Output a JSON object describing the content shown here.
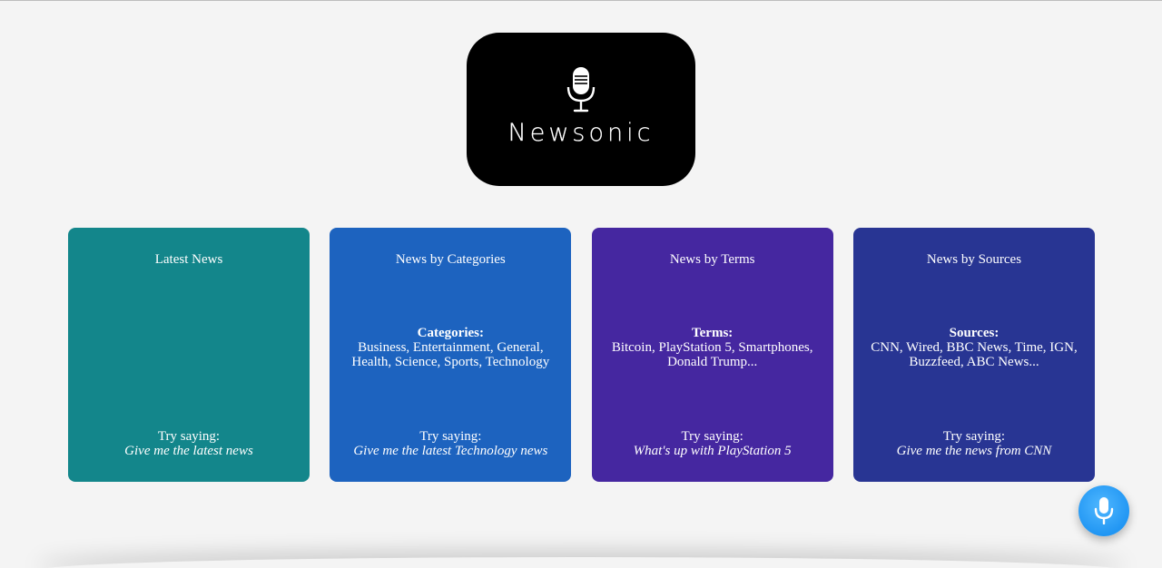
{
  "logo": {
    "wordmark": "Newsonic",
    "icon": "microphone-icon"
  },
  "cards": [
    {
      "title": "Latest News",
      "info_head": "",
      "info_body": "",
      "try_label": "Try saying:",
      "example": "Give me the latest news",
      "color": "#13868b"
    },
    {
      "title": "News by Categories",
      "info_head": "Categories:",
      "info_body": "Business, Entertainment, General, Health, Science, Sports, Technology",
      "try_label": "Try saying:",
      "example": "Give me the latest Technology news",
      "color": "#1d63bf"
    },
    {
      "title": "News by Terms",
      "info_head": "Terms:",
      "info_body": "Bitcoin, PlayStation 5, Smartphones, Donald Trump...",
      "try_label": "Try saying:",
      "example": "What's up with PlayStation 5",
      "color": "#4527a0"
    },
    {
      "title": "News by Sources",
      "info_head": "Sources:",
      "info_body": "CNN, Wired, BBC News, Time, IGN, Buzzfeed, ABC News...",
      "try_label": "Try saying:",
      "example": "Give me the news from CNN",
      "color": "#283593"
    }
  ],
  "voice_button": {
    "icon": "microphone-icon",
    "color": "#2196f3"
  }
}
